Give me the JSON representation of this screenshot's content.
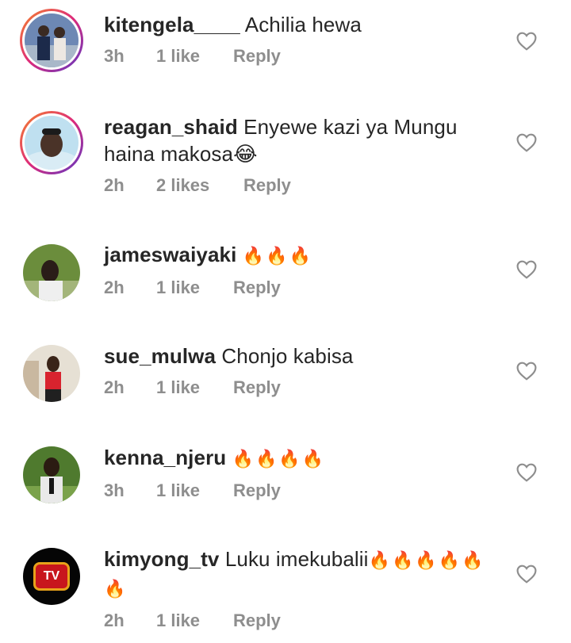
{
  "comments": [
    {
      "username": "kitengela____",
      "text": "Achilia hewa",
      "emoji": "",
      "time": "3h",
      "likes": "1 like",
      "reply": "Reply",
      "avatar": "story-ring"
    },
    {
      "username": "reagan_shaid",
      "text": "Enyewe kazi ya Mungu haina makosa",
      "emoji": "😂",
      "time": "2h",
      "likes": "2 likes",
      "reply": "Reply",
      "avatar": "story-ring"
    },
    {
      "username": "jameswaiyaki",
      "text": "",
      "emoji": "🔥🔥🔥",
      "time": "2h",
      "likes": "1 like",
      "reply": "Reply",
      "avatar": "plain"
    },
    {
      "username": "sue_mulwa",
      "text": "Chonjo kabisa",
      "emoji": "",
      "time": "2h",
      "likes": "1 like",
      "reply": "Reply",
      "avatar": "plain"
    },
    {
      "username": "kenna_njeru",
      "text": "",
      "emoji": "🔥🔥🔥🔥",
      "time": "3h",
      "likes": "1 like",
      "reply": "Reply",
      "avatar": "plain"
    },
    {
      "username": "kimyong_tv",
      "text": "Luku imekubalii",
      "emoji": "🔥🔥🔥🔥🔥🔥",
      "time": "2h",
      "likes": "1 like",
      "reply": "Reply",
      "avatar": "plain"
    }
  ],
  "kimyong_logo_text": "TV",
  "colors": {
    "meta": "#8e8e8e",
    "text": "#262626",
    "story_ring_start": "#f58529",
    "story_ring_end": "#8134af"
  },
  "icons": {
    "like": "heart-outline-icon"
  }
}
